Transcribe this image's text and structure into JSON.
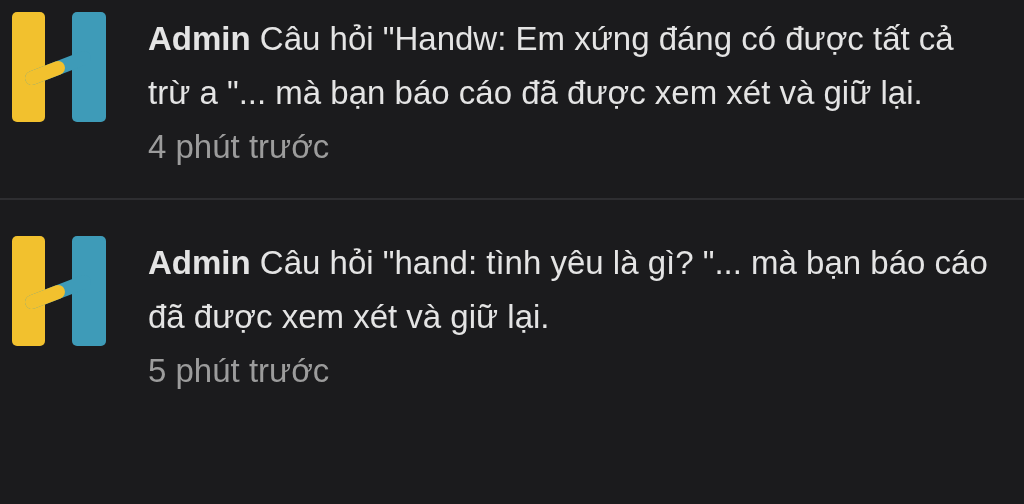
{
  "notifications": [
    {
      "message": "**Admin** Câu hỏi \"Handw: Em xứng đáng có được tất cả trừ a \"... mà bạn báo cáo đã được xem xét và giữ lại.",
      "time": "4 phút trước"
    },
    {
      "message": "**Admin** Câu hỏi \"hand: tình yêu là gì? \"... mà bạn báo cáo đã được xem xét và giữ lại.",
      "time": "5 phút trước"
    }
  ]
}
